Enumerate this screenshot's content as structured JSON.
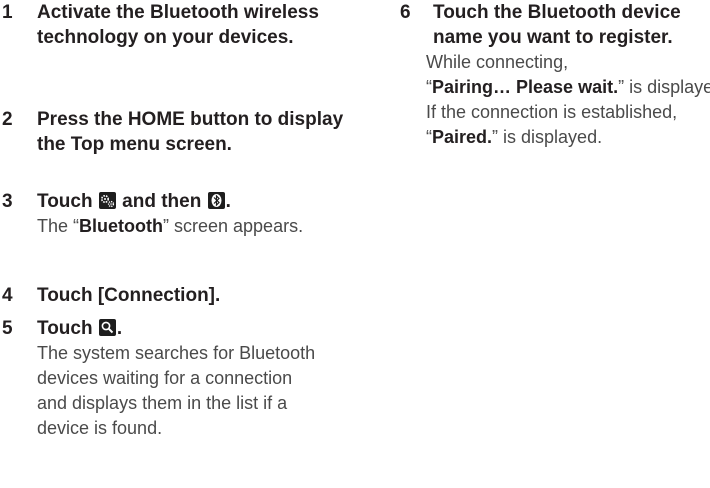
{
  "steps_left": [
    {
      "num": "1",
      "heading": "Activate the Bluetooth wireless technology on your devices."
    },
    {
      "num": "2",
      "heading": "Press the HOME button to display the Top menu screen."
    },
    {
      "num": "3",
      "heading_pre": "Touch",
      "heading_mid": "and then",
      "heading_end": ".",
      "desc_pre": "The “",
      "desc_bold": "Bluetooth",
      "desc_post": "” screen appears.",
      "icon1": "settings-gear-icon",
      "icon2": "bluetooth-icon"
    },
    {
      "num": "4",
      "heading": "Touch [Connection]."
    },
    {
      "num": "5",
      "heading_pre": "Touch",
      "heading_end": ".",
      "desc": "The system searches for Bluetooth devices waiting for a connection and displays them in the list if a device is found.",
      "icon1": "search-icon"
    }
  ],
  "steps_right": [
    {
      "num": "6",
      "heading": "Touch the Bluetooth device name you want to register.",
      "desc_line1": "While connecting,",
      "desc_q1": "“",
      "desc_bold1": "Pairing… Please wait.",
      "desc_mid": "” is displayed. If the connection is established, “",
      "desc_bold2": "Paired.",
      "desc_end": "” is displayed."
    }
  ]
}
